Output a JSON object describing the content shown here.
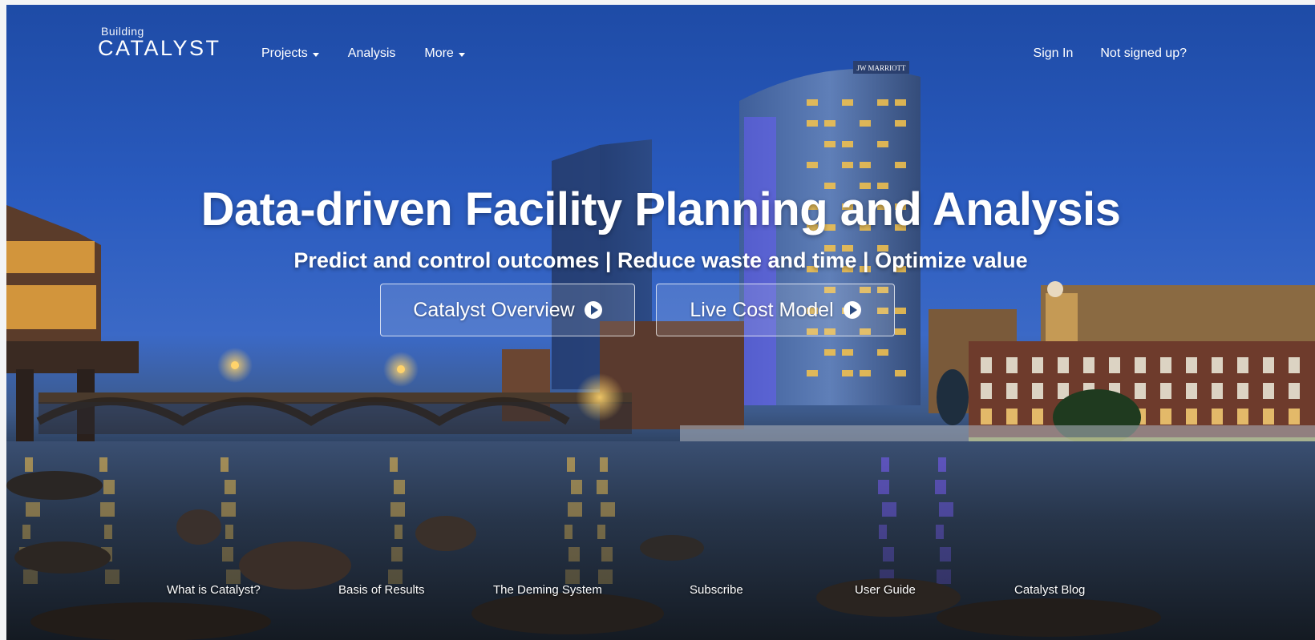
{
  "brand": {
    "line1": "Building",
    "line2": "CATALYST"
  },
  "nav": {
    "projects": "Projects",
    "analysis": "Analysis",
    "more": "More",
    "sign_in": "Sign In",
    "not_signed_up": "Not signed up?"
  },
  "hero": {
    "title": "Data-driven Facility Planning and Analysis",
    "subtitle": "Predict and control outcomes | Reduce waste and time | Optimize value",
    "button_overview": "Catalyst Overview",
    "button_cost": "Live Cost Model"
  },
  "scene": {
    "hotel_sign": "JW MARRIOTT"
  },
  "footer": {
    "what_is": "What is Catalyst?",
    "basis": "Basis of Results",
    "deming": "The Deming System",
    "subscribe": "Subscribe",
    "user_guide": "User Guide",
    "blog": "Catalyst Blog"
  },
  "colors": {
    "sky_top": "#1e4ba6",
    "sky_mid": "#3b69c6",
    "water": "#1f2b3a",
    "light_glow": "#f7c34a",
    "purple_glow": "#7c5cff"
  }
}
